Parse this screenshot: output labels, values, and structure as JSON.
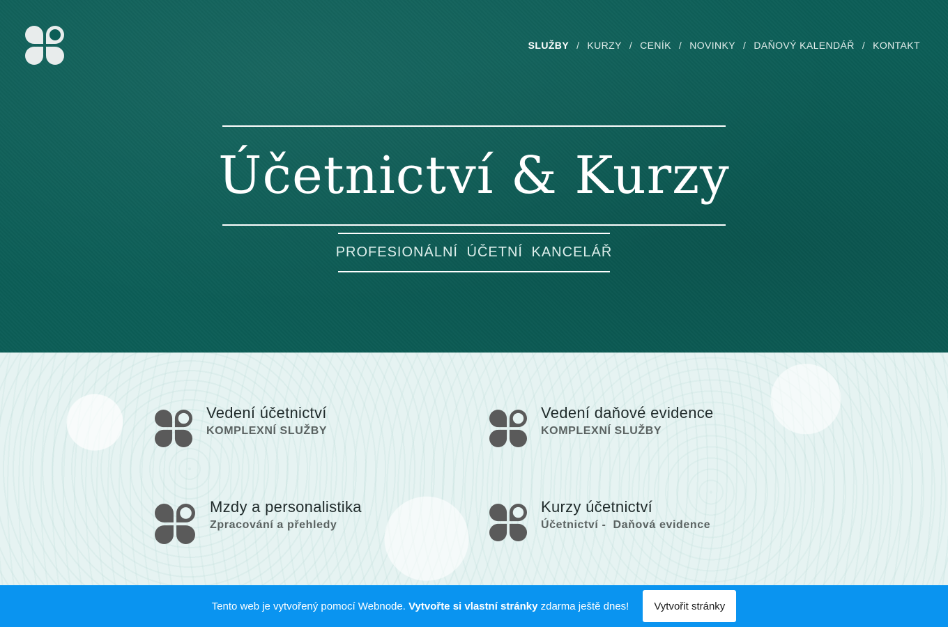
{
  "colors": {
    "hero_bg": "#0c5e57",
    "services_bg": "#e6f3f2",
    "banner_bg": "#0a94f0",
    "logo_light": "#e8ecec",
    "icon_dark": "#5a5a5a"
  },
  "header": {
    "logo_icon": "clover-logo-icon",
    "nav": [
      {
        "label": "SLUŽBY",
        "active": true
      },
      {
        "label": "KURZY",
        "active": false
      },
      {
        "label": "CENÍK",
        "active": false
      },
      {
        "label": "NOVINKY",
        "active": false
      },
      {
        "label": "DAŇOVÝ KALENDÁŘ",
        "active": false
      },
      {
        "label": "KONTAKT",
        "active": false
      }
    ],
    "separator": "/"
  },
  "hero": {
    "title": "Účetnictví & Kurzy",
    "subtitle": "PROFESIONÁLNÍ ÚČETNÍ KANCELÁŘ"
  },
  "services": [
    {
      "icon": "clover-icon",
      "title": "Vedení účetnictví",
      "subtitle": "KOMPLEXNÍ SLUŽBY"
    },
    {
      "icon": "clover-icon",
      "title": "Vedení daňové evidence",
      "subtitle": "KOMPLEXNÍ SLUŽBY"
    },
    {
      "icon": "clover-icon",
      "title": "Mzdy a personalistika",
      "subtitle": "Zpracování a přehledy"
    },
    {
      "icon": "clover-icon",
      "title": "Kurzy účetnictví",
      "subtitle": "Účetnictví -  Daňová evidence"
    }
  ],
  "banner": {
    "text_before": "Tento web je vytvořený pomocí Webnode. ",
    "text_bold": "Vytvořte si vlastní stránky",
    "text_after": " zdarma ještě dnes!",
    "button_label": "Vytvořit stránky"
  }
}
